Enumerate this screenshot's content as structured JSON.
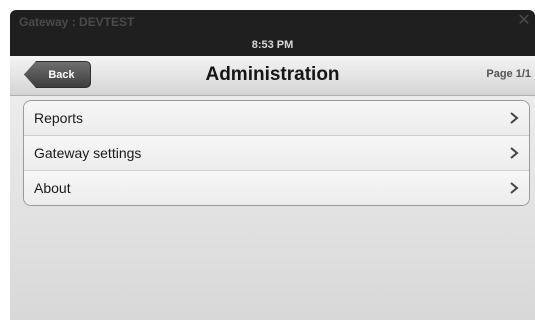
{
  "window": {
    "title": "Gateway : DEVTEST",
    "close_icon": "close-icon",
    "time": "8:53 PM"
  },
  "navbar": {
    "back_label": "Back",
    "title": "Administration",
    "page_indicator": "Page 1/1"
  },
  "menu": {
    "items": [
      {
        "label": "Reports",
        "icon": "chevron-right-icon"
      },
      {
        "label": "Gateway settings",
        "icon": "chevron-right-icon"
      },
      {
        "label": "About",
        "icon": "chevron-right-icon"
      }
    ]
  }
}
